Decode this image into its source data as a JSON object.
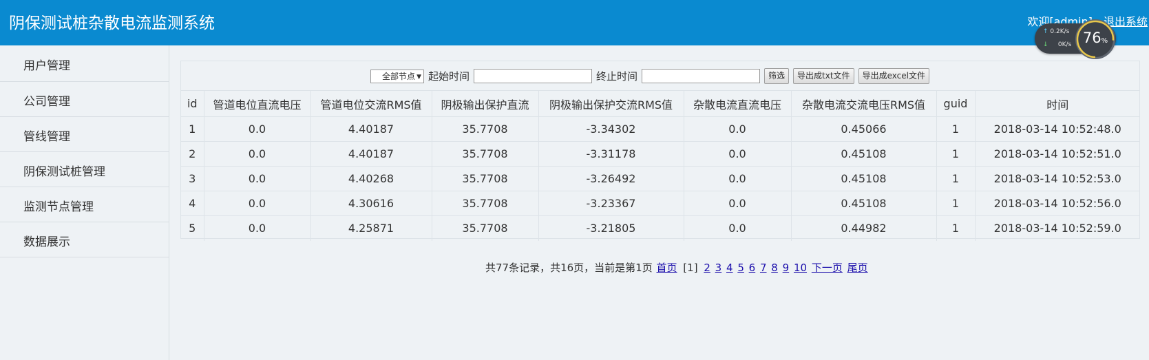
{
  "header": {
    "title": "阴保测试桩杂散电流监测系统",
    "welcome_prefix": "欢迎[",
    "username": "admin",
    "welcome_suffix": "]，",
    "logout": "退出系统"
  },
  "net_widget": {
    "upload": "0.2",
    "upload_unit": "K/s",
    "download": "0",
    "download_unit": "K/s",
    "percent": "76",
    "percent_unit": "%"
  },
  "sidebar": {
    "items": [
      {
        "label": "用户管理"
      },
      {
        "label": "公司管理"
      },
      {
        "label": "管线管理"
      },
      {
        "label": "阴保测试桩管理"
      },
      {
        "label": "监测节点管理"
      },
      {
        "label": "数据展示"
      }
    ]
  },
  "filter": {
    "node_select": "全部节点",
    "start_label": "起始时间",
    "start_value": "",
    "end_label": "终止时间",
    "end_value": "",
    "filter_button": "筛选",
    "export_txt_button": "导出成txt文件",
    "export_excel_button": "导出成excel文件"
  },
  "table": {
    "headers": [
      "id",
      "管道电位直流电压",
      "管道电位交流RMS值",
      "阴极输出保护直流",
      "阴极输出保护交流RMS值",
      "杂散电流直流电压",
      "杂散电流交流电压RMS值",
      "guid",
      "时间"
    ],
    "rows": [
      [
        "1",
        "0.0",
        "4.40187",
        "35.7708",
        "-3.34302",
        "0.0",
        "0.45066",
        "1",
        "2018-03-14 10:52:48.0"
      ],
      [
        "2",
        "0.0",
        "4.40187",
        "35.7708",
        "-3.31178",
        "0.0",
        "0.45108",
        "1",
        "2018-03-14 10:52:51.0"
      ],
      [
        "3",
        "0.0",
        "4.40268",
        "35.7708",
        "-3.26492",
        "0.0",
        "0.45108",
        "1",
        "2018-03-14 10:52:53.0"
      ],
      [
        "4",
        "0.0",
        "4.30616",
        "35.7708",
        "-3.23367",
        "0.0",
        "0.45108",
        "1",
        "2018-03-14 10:52:56.0"
      ],
      [
        "5",
        "0.0",
        "4.25871",
        "35.7708",
        "-3.21805",
        "0.0",
        "0.44982",
        "1",
        "2018-03-14 10:52:59.0"
      ]
    ]
  },
  "pager": {
    "summary": "共77条记录，共16页，当前是第1页",
    "first": "首页",
    "current": "[1]",
    "pages": [
      "2",
      "3",
      "4",
      "5",
      "6",
      "7",
      "8",
      "9",
      "10"
    ],
    "next": "下一页",
    "last": "尾页"
  }
}
